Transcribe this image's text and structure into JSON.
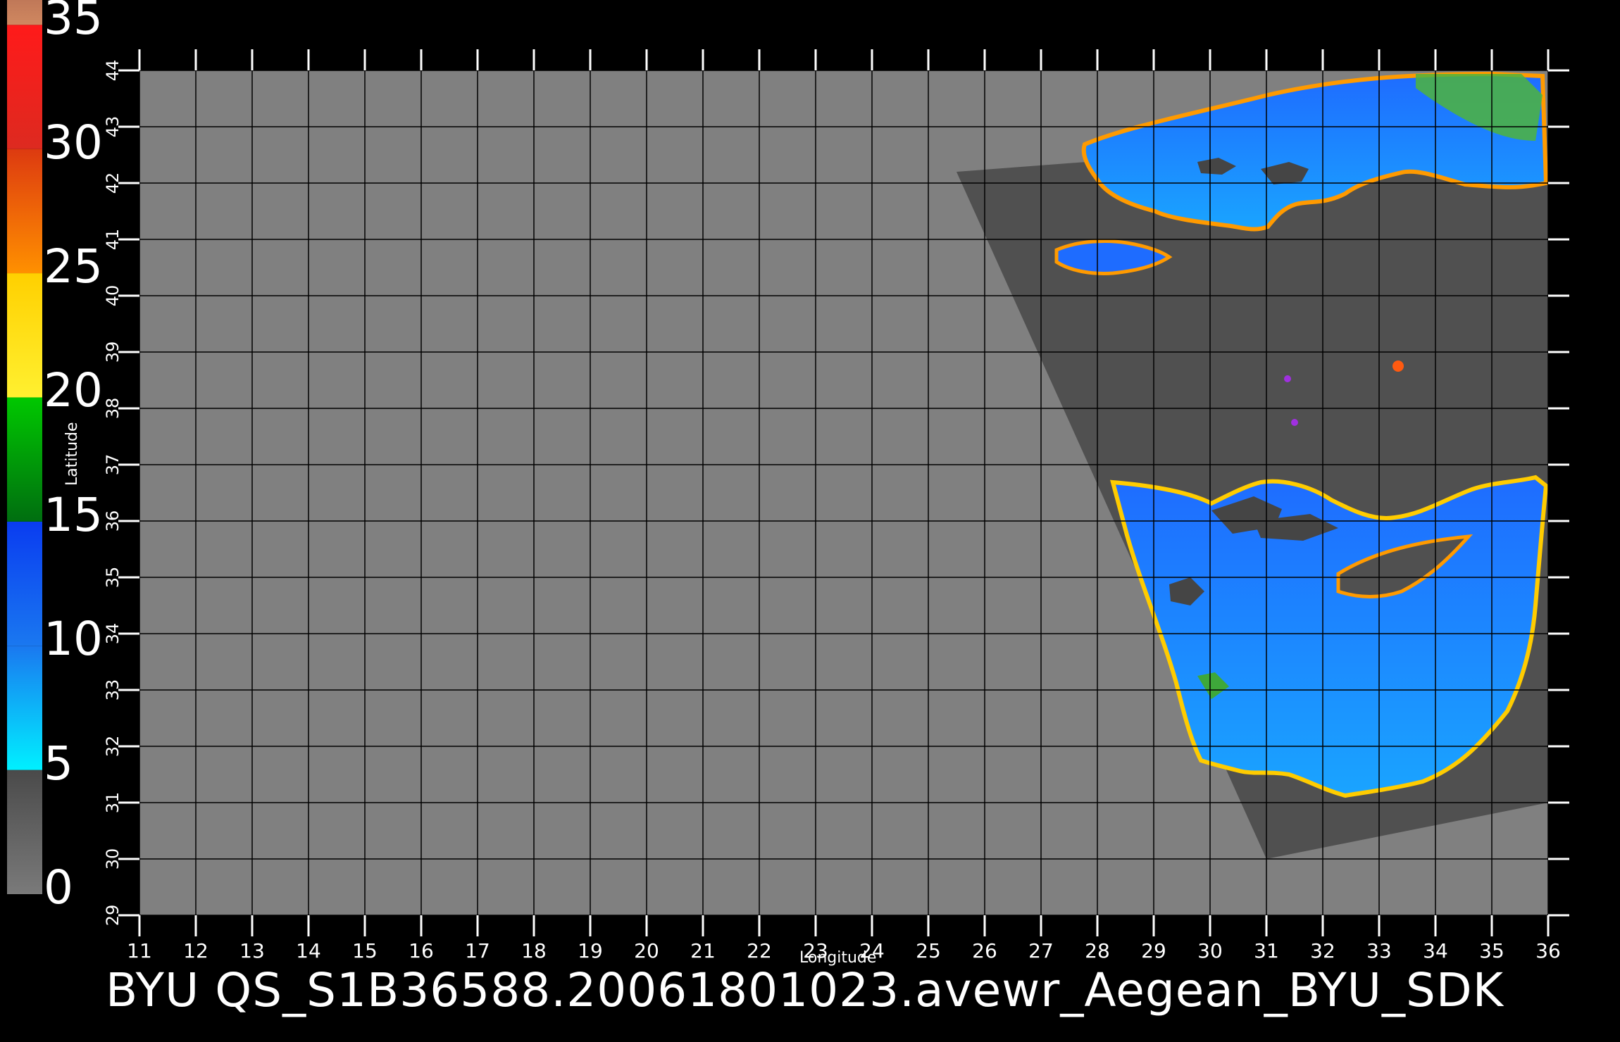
{
  "colorbar": {
    "labels": [
      "0",
      "5",
      "10",
      "15",
      "20",
      "25",
      "30",
      "35"
    ],
    "bands": [
      {
        "from": 0,
        "to": 5,
        "top": "#4a4a4a",
        "bottom": "#7a7a7a"
      },
      {
        "from": 5,
        "to": 10,
        "top": "#1a78f0",
        "bottom": "#00f0ff"
      },
      {
        "from": 10,
        "to": 15,
        "top": "#0a3cf0",
        "bottom": "#1a78f0"
      },
      {
        "from": 15,
        "to": 20,
        "top": "#00c800",
        "bottom": "#006e10"
      },
      {
        "from": 20,
        "to": 25,
        "top": "#ffd000",
        "bottom": "#fff030"
      },
      {
        "from": 25,
        "to": 30,
        "top": "#dd3a10",
        "bottom": "#ff9000"
      },
      {
        "from": 30,
        "to": 35,
        "top": "#ff1a1a",
        "bottom": "#dd2a20"
      },
      {
        "from": 35,
        "to": 36,
        "top": "#c07858",
        "bottom": "#d08860"
      }
    ]
  },
  "map": {
    "xlabel": "Longitude",
    "ylabel": "Latitude",
    "lon_range": [
      11,
      36
    ],
    "lat_range": [
      29,
      44
    ],
    "lon_ticks": [
      11,
      12,
      13,
      14,
      15,
      16,
      17,
      18,
      19,
      20,
      21,
      22,
      23,
      24,
      25,
      26,
      27,
      28,
      29,
      30,
      31,
      32,
      33,
      34,
      35,
      36
    ],
    "lat_ticks": [
      29,
      30,
      31,
      32,
      33,
      34,
      35,
      36,
      37,
      38,
      39,
      40,
      41,
      42,
      43,
      44
    ],
    "background_color": "#808080",
    "swath_color": "#505050",
    "grid_color": "#000000",
    "swath_corners_lonlat": [
      [
        25.5,
        42.2
      ],
      [
        36.0,
        43.0
      ],
      [
        36.0,
        31.0
      ],
      [
        31.0,
        30.0
      ]
    ]
  },
  "footer": {
    "text": "BYU  QS_S1B36588.20061801023.avewr_Aegean_BYU_SDK"
  }
}
